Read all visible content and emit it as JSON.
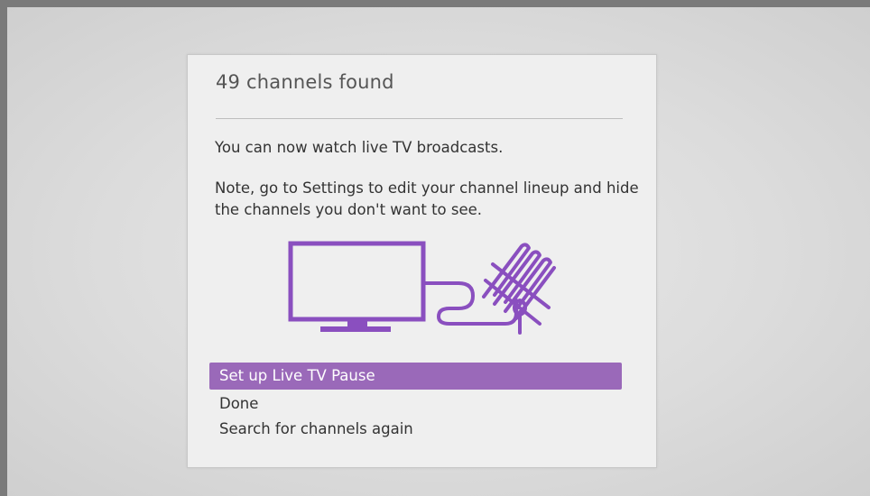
{
  "dialog": {
    "title": "49 channels found",
    "message": "You can now watch live TV broadcasts.",
    "note": "Note, go to Settings to edit your channel lineup and hide the channels you don't want to see."
  },
  "illustration": {
    "icons": [
      "tv-icon",
      "cable-icon",
      "antenna-icon"
    ],
    "color": "#8a4fbf"
  },
  "menu": {
    "items": [
      {
        "label": "Set up Live TV Pause",
        "selected": true
      },
      {
        "label": "Done",
        "selected": false
      },
      {
        "label": "Search for channels again",
        "selected": false
      }
    ]
  },
  "colors": {
    "accent": "#9a69b9",
    "frame": "#7a7a7a",
    "dialog_bg": "#efefef"
  }
}
